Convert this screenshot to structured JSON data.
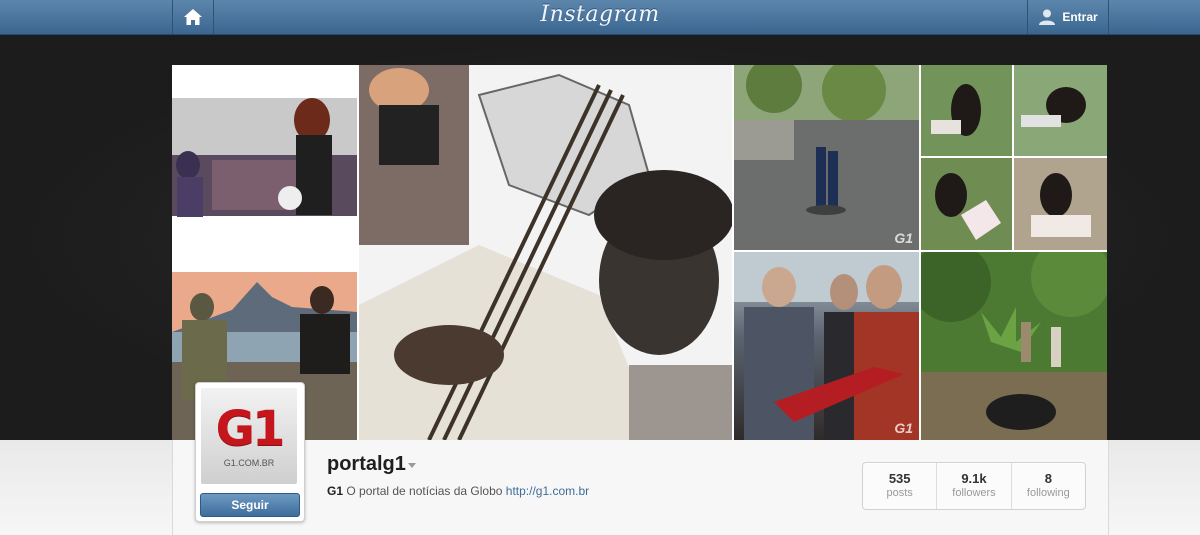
{
  "header": {
    "logo": "Instagram",
    "home_icon": "home-icon",
    "login_label": "Entrar",
    "login_icon": "user-silhouette-icon"
  },
  "gallery": {
    "watermark": "G1"
  },
  "profile": {
    "avatar_logo": "G1",
    "avatar_site": "G1.COM.BR",
    "follow_label": "Seguir",
    "username": "portalg1",
    "bio_name": "G1",
    "bio_text": " O portal de notícias da Globo ",
    "bio_link": "http://g1.com.br",
    "stats": [
      {
        "value": "535",
        "label": "posts"
      },
      {
        "value": "9.1k",
        "label": "followers"
      },
      {
        "value": "8",
        "label": "following"
      }
    ]
  },
  "colors": {
    "topbar": "#4a75a0",
    "g1_red": "#c4161c",
    "button_blue": "#3d6d9c"
  }
}
